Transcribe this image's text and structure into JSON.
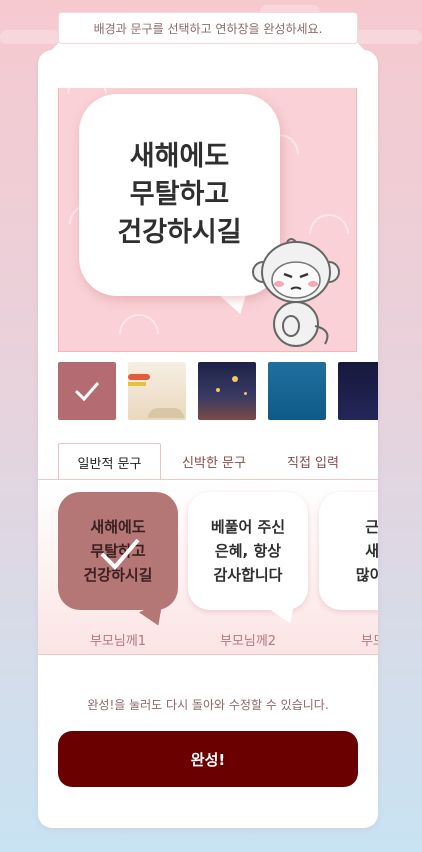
{
  "instruction": "배경과 문구를 선택하고 연하장을 완성하세요.",
  "preview": {
    "message": "새해에도\n무탈하고\n건강하시길"
  },
  "backgrounds": [
    {
      "name": "pink",
      "selected": true
    },
    {
      "name": "beige-landscape",
      "selected": false
    },
    {
      "name": "lantern-night",
      "selected": false
    },
    {
      "name": "blue-sea",
      "selected": false
    },
    {
      "name": "night-sky",
      "selected": false
    }
  ],
  "tabs": [
    {
      "label": "일반적 문구",
      "active": true
    },
    {
      "label": "신박한 문구",
      "active": false
    },
    {
      "label": "직접 입력",
      "active": false
    }
  ],
  "phrases": [
    {
      "text": "새해에도\n무탈하고\n건강하시길",
      "label": "부모님께1",
      "selected": true
    },
    {
      "text": "베풀어 주신\n은혜, 항상\n감사합니다",
      "label": "부모님께2",
      "selected": false
    },
    {
      "text": "근하\n새해\n많이 받",
      "label": "부모님",
      "selected": false
    }
  ],
  "note": "완성!을 눌러도 다시 돌아와 수정할 수 있습니다.",
  "done_button": "완성!",
  "colors": {
    "accent": "#6b0000",
    "selected_phrase": "#b57676",
    "preview_bg": "#f9d1d6"
  }
}
